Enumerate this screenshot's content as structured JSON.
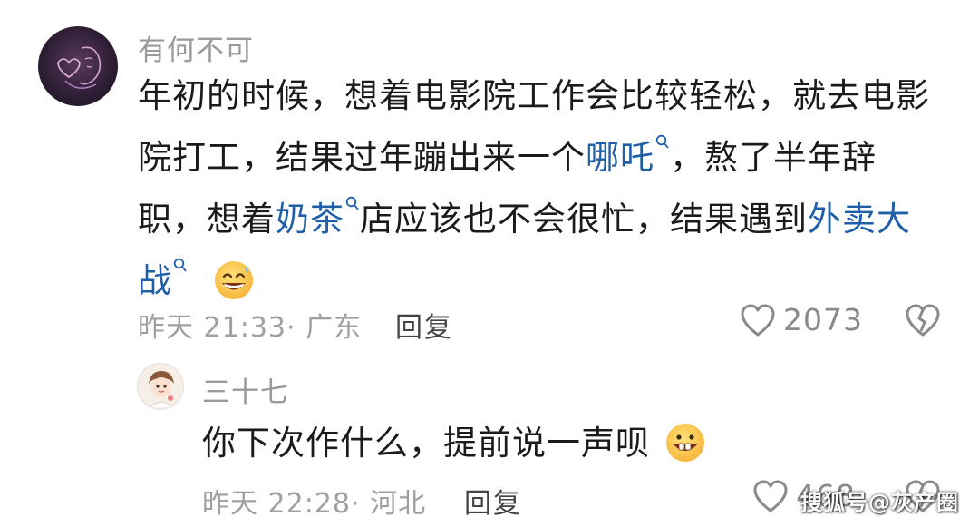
{
  "comment_main": {
    "username": "有何不可",
    "text_part1": "年初的时候，想着电影院工作会比较轻松，就去电影",
    "text_part2a": "院打工，结果过年蹦出来一个",
    "link1": "哪吒",
    "text_part2b": "，熬了半年辞",
    "text_part3a": "职，想着",
    "link2": "奶茶",
    "text_part3b": "店应该也不会很忙，结果遇到",
    "link3a": "外卖大",
    "link3b": "战",
    "time": "昨天 21:33",
    "location": "· 广东",
    "reply_label": "回复",
    "like_count": "2073",
    "emoji": "grinning-sweat-emoji"
  },
  "comment_reply": {
    "username": "三十七",
    "text": "你下次作什么，提前说一声呗",
    "time": "昨天 22:28",
    "location": "· 河北",
    "reply_label": "回复",
    "like_count": "468",
    "emoji": "buck-tooth-grin-emoji"
  },
  "watermark": "搜狐号@灰产圈",
  "colors": {
    "link": "#1f5fa8",
    "meta": "#a0a0a0",
    "username": "#9a9a9a"
  }
}
